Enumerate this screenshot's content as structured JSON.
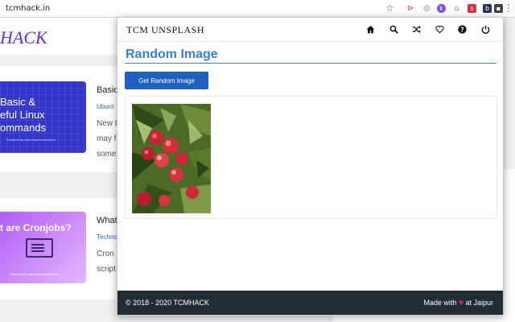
{
  "browser": {
    "url": "tcmhack.in",
    "star_icon": "star-icon",
    "extensions": [
      {
        "name": "ext-cast",
        "color": "#e03b3b",
        "glyph": "⊳"
      },
      {
        "name": "ext-globe",
        "color": "#777777",
        "glyph": "◎"
      },
      {
        "name": "ext-k",
        "color": "#7b4fd6",
        "glyph": "k"
      },
      {
        "name": "ext-gift",
        "color": "#999999",
        "glyph": "⌂"
      },
      {
        "name": "ext-s",
        "color": "#d9323f",
        "glyph": "s"
      },
      {
        "name": "ext-b",
        "color": "#2b2f5e",
        "glyph": "b"
      },
      {
        "name": "ext-tcm",
        "color": "#444444",
        "glyph": "▪"
      }
    ]
  },
  "site": {
    "logo": "HACK",
    "posts": [
      {
        "thumb_text": "Basic &\neful Linux\nommands",
        "thumb_tiny": "Powered by http://www.tcmhack.in",
        "title": "Basic",
        "category": "Ubunt",
        "excerpt": "New L\nmay f\nsome"
      },
      {
        "thumb_text": "t are Cronjobs?",
        "thumb_tiny": "Powered by http://www.tcmhack.in",
        "title": "What",
        "category": "Techno",
        "excerpt": "Cron\nscript"
      }
    ]
  },
  "popup": {
    "brand": "TCM UNSPLASH",
    "nav": [
      {
        "name": "home-icon"
      },
      {
        "name": "search-icon"
      },
      {
        "name": "shuffle-icon"
      },
      {
        "name": "heart-icon"
      },
      {
        "name": "help-icon"
      },
      {
        "name": "power-icon"
      }
    ],
    "heading": "Random Image",
    "button_label": "Get Random Image",
    "footer": {
      "copyright": "© 2018 - 2020 TCMHACK",
      "made_with_prefix": "Made with",
      "made_with_suffix": "at Jaipur"
    }
  }
}
